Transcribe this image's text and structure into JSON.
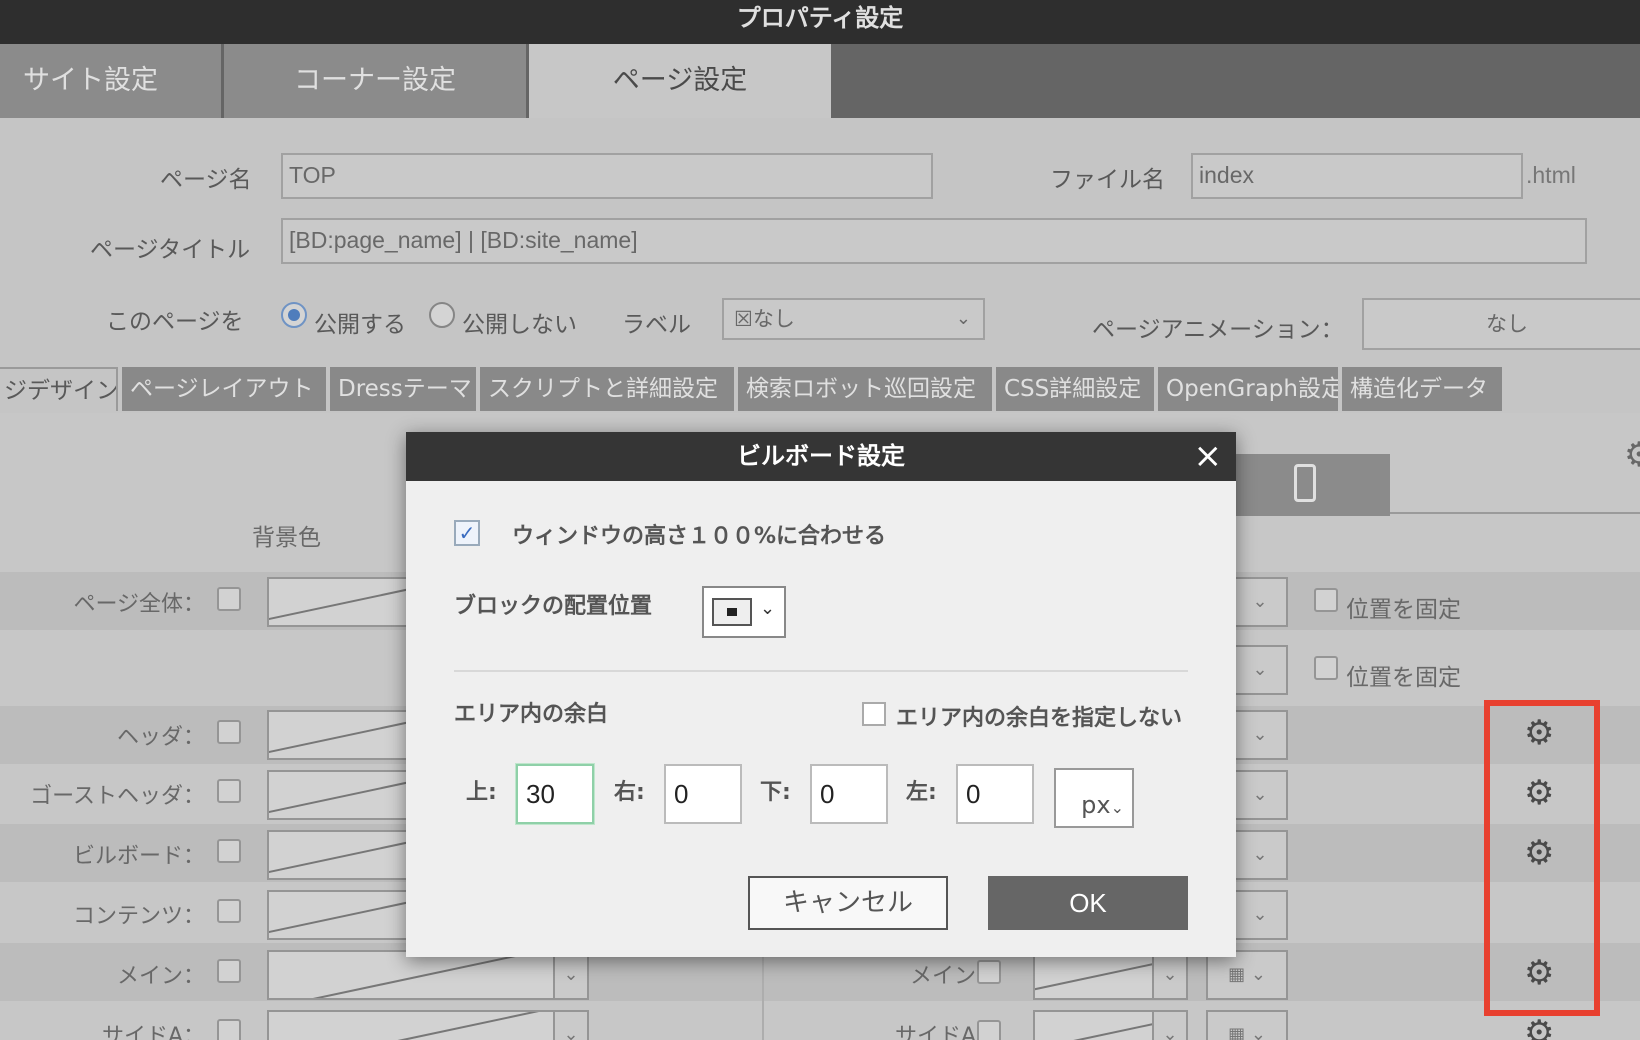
{
  "window_title": "プロパティ設定",
  "top_tabs": [
    {
      "label": "サイト設定"
    },
    {
      "label": "コーナー設定"
    },
    {
      "label": "ページ設定",
      "active": true
    }
  ],
  "form": {
    "page_name_label": "ページ名",
    "page_name_value": "TOP",
    "file_name_label": "ファイル名",
    "file_name_value": "index",
    "file_ext": ".html",
    "page_title_label": "ページタイトル",
    "page_title_value": "[BD:page_name] | [BD:site_name]",
    "publish_label": "このページを",
    "publish_yes": "公開する",
    "publish_no": "公開しない",
    "label_label": "ラベル",
    "label_value": "☒なし",
    "animation_label": "ページアニメーション：",
    "animation_value": "なし"
  },
  "sub_tabs": [
    {
      "label": "ジデザイン",
      "active": true
    },
    {
      "label": "ページレイアウト"
    },
    {
      "label": "Dressテーマ"
    },
    {
      "label": "スクリプトと詳細設定"
    },
    {
      "label": "検索ロボット巡回設定"
    },
    {
      "label": "CSS詳細設定"
    },
    {
      "label": "OpenGraph設定"
    },
    {
      "label": "構造化データ"
    }
  ],
  "layout": {
    "bg_color_label": "背景色",
    "rows": [
      {
        "label": "ページ全体："
      },
      {
        "label": "ヘッダ："
      },
      {
        "label": "ゴーストヘッダ："
      },
      {
        "label": "ビルボード："
      },
      {
        "label": "コンテンツ："
      },
      {
        "label": "メイン："
      },
      {
        "label": "サイドA："
      }
    ],
    "right_labels": [
      "メイン：",
      "サイドA："
    ],
    "fix_position_label": "位置を固定",
    "fix_position_label_2": "位置を固定"
  },
  "dialog": {
    "title": "ビルボード設定",
    "close_icon": "×",
    "fit_height_label": "ウィンドウの高さ１００%に合わせる",
    "fit_height_checked": true,
    "block_position_label": "ブロックの配置位置",
    "padding_label": "エリア内の余白",
    "no_padding_label": "エリア内の余白を指定しない",
    "top_label": "上:",
    "right_label": "右:",
    "bottom_label": "下:",
    "left_label": "左:",
    "top_value": "30",
    "right_value": "0",
    "bottom_value": "0",
    "left_value": "0",
    "unit_value": "px",
    "cancel_label": "キャンセル",
    "ok_label": "OK"
  },
  "colors": {
    "dialog_title_bg": "#353535",
    "ok_button": "#666666",
    "highlight_box": "#e8402f",
    "focus_border": "#8fd0a8"
  }
}
